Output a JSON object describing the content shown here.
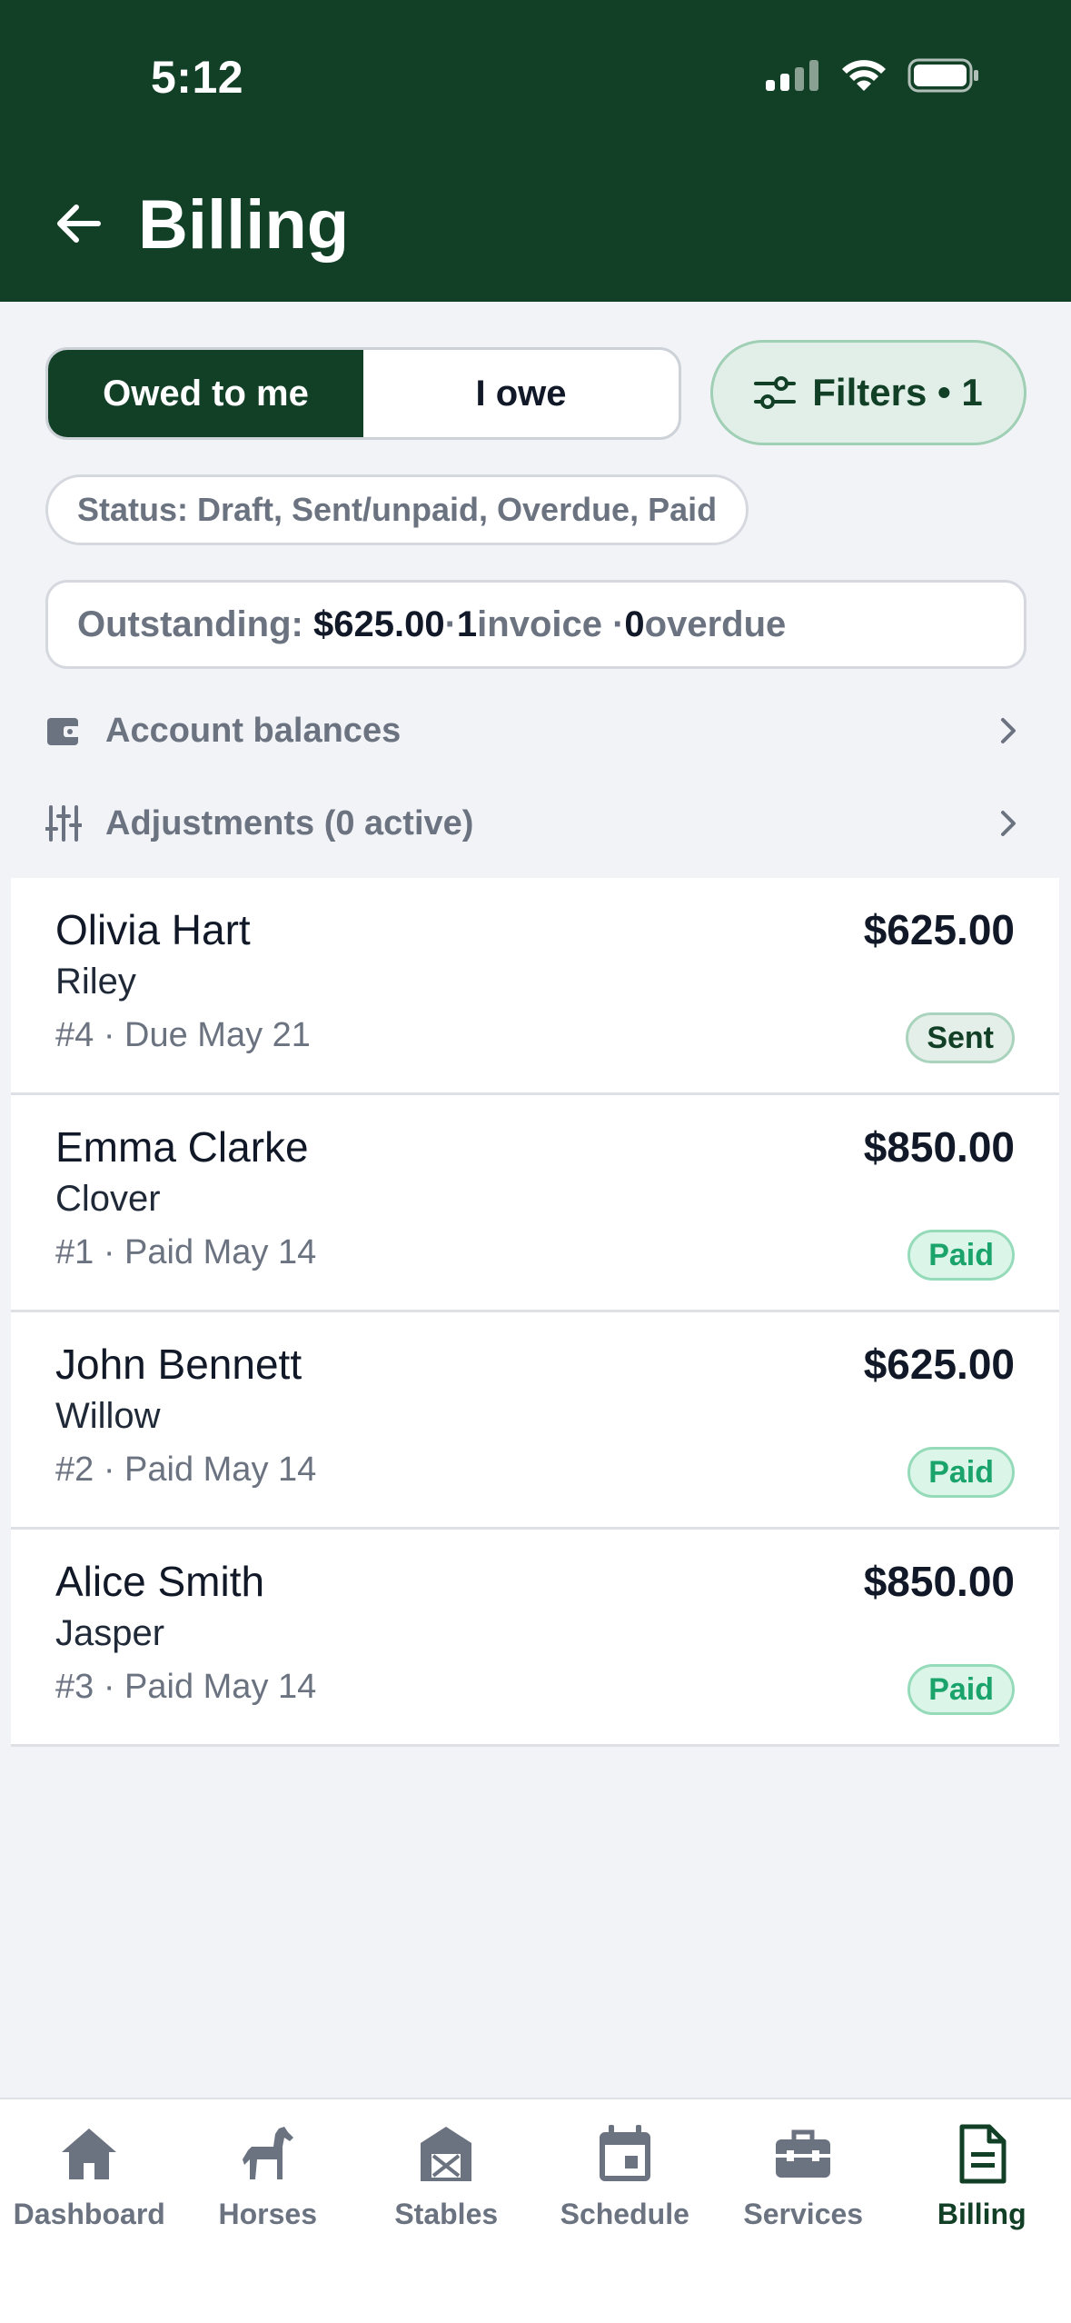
{
  "status_bar": {
    "time": "5:12"
  },
  "header": {
    "title": "Billing"
  },
  "segment": {
    "options": [
      "Owed to me",
      "I owe"
    ],
    "selected": "Owed to me"
  },
  "filters": {
    "label": "Filters • 1"
  },
  "status_filter": {
    "label": "Status: Draft, Sent/unpaid, Overdue, Paid"
  },
  "summary": {
    "prefix": "Outstanding: ",
    "amount": "$625.00",
    "sep1": " · ",
    "invoice_count": "1",
    "invoice_label": " invoice · ",
    "overdue_count": "0",
    "overdue_label": " overdue"
  },
  "links": {
    "account_balances": "Account balances",
    "adjustments": "Adjustments (0 active)"
  },
  "invoices": [
    {
      "client": "Olivia Hart",
      "horse": "Riley",
      "meta": "#4  ·  Due May 21",
      "amount": "$625.00",
      "status": "Sent"
    },
    {
      "client": "Emma Clarke",
      "horse": "Clover",
      "meta": "#1  ·  Paid May 14",
      "amount": "$850.00",
      "status": "Paid"
    },
    {
      "client": "John Bennett",
      "horse": "Willow",
      "meta": "#2  ·  Paid May 14",
      "amount": "$625.00",
      "status": "Paid"
    },
    {
      "client": "Alice Smith",
      "horse": "Jasper",
      "meta": "#3  ·  Paid May 14",
      "amount": "$850.00",
      "status": "Paid"
    }
  ],
  "tabs": [
    {
      "label": "Dashboard",
      "icon": "home-icon"
    },
    {
      "label": "Horses",
      "icon": "horse-icon"
    },
    {
      "label": "Stables",
      "icon": "stable-icon"
    },
    {
      "label": "Schedule",
      "icon": "calendar-icon"
    },
    {
      "label": "Services",
      "icon": "toolbox-icon"
    },
    {
      "label": "Billing",
      "icon": "invoice-icon",
      "active": true
    }
  ],
  "colors": {
    "brand": "#124027",
    "paid": "#1aa36a",
    "background": "#f2f3f6"
  }
}
